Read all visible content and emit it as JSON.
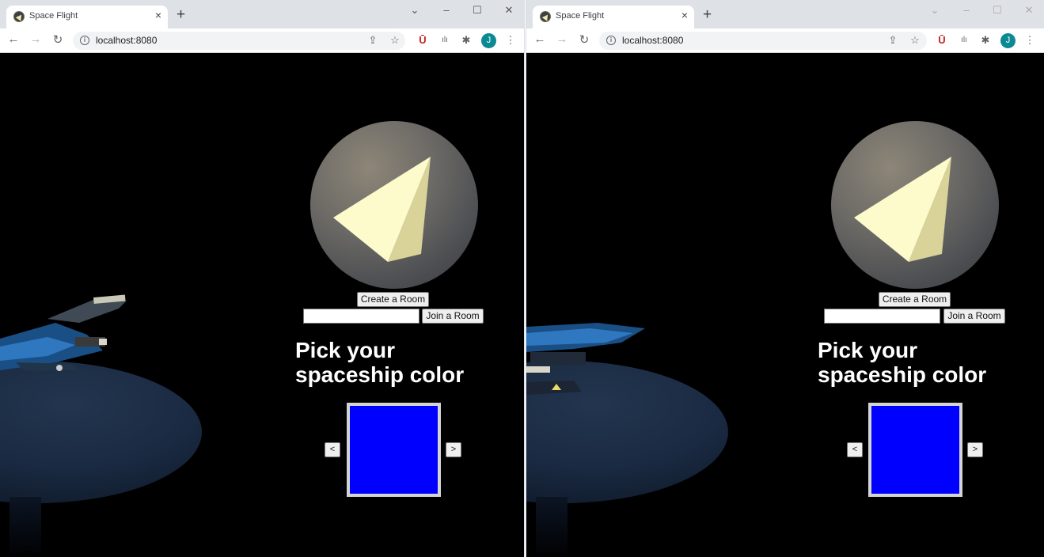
{
  "windows": [
    {
      "tab_title": "Space Flight",
      "url": "localhost:8080",
      "avatar_letter": "J",
      "create_room_label": "Create a Room",
      "join_room_label": "Join a Room",
      "room_code_value": "",
      "heading_line1": "Pick your",
      "heading_line2": "spaceship color",
      "prev_label": "<",
      "next_label": ">",
      "selected_color": "#0000ff"
    },
    {
      "tab_title": "Space Flight",
      "url": "localhost:8080",
      "avatar_letter": "J",
      "create_room_label": "Create a Room",
      "join_room_label": "Join a Room",
      "room_code_value": "",
      "heading_line1": "Pick your",
      "heading_line2": "spaceship color",
      "prev_label": "<",
      "next_label": ">",
      "selected_color": "#0000ff"
    }
  ],
  "icons": {
    "close": "×",
    "new_tab": "+",
    "back": "←",
    "forward": "→",
    "reload": "↻",
    "minimize": "–",
    "maximize": "☐",
    "window_close": "✕",
    "chevron": "⌄",
    "share": "⇪",
    "star": "☆",
    "extension": "✱",
    "menu": "⋮",
    "info": "i"
  }
}
